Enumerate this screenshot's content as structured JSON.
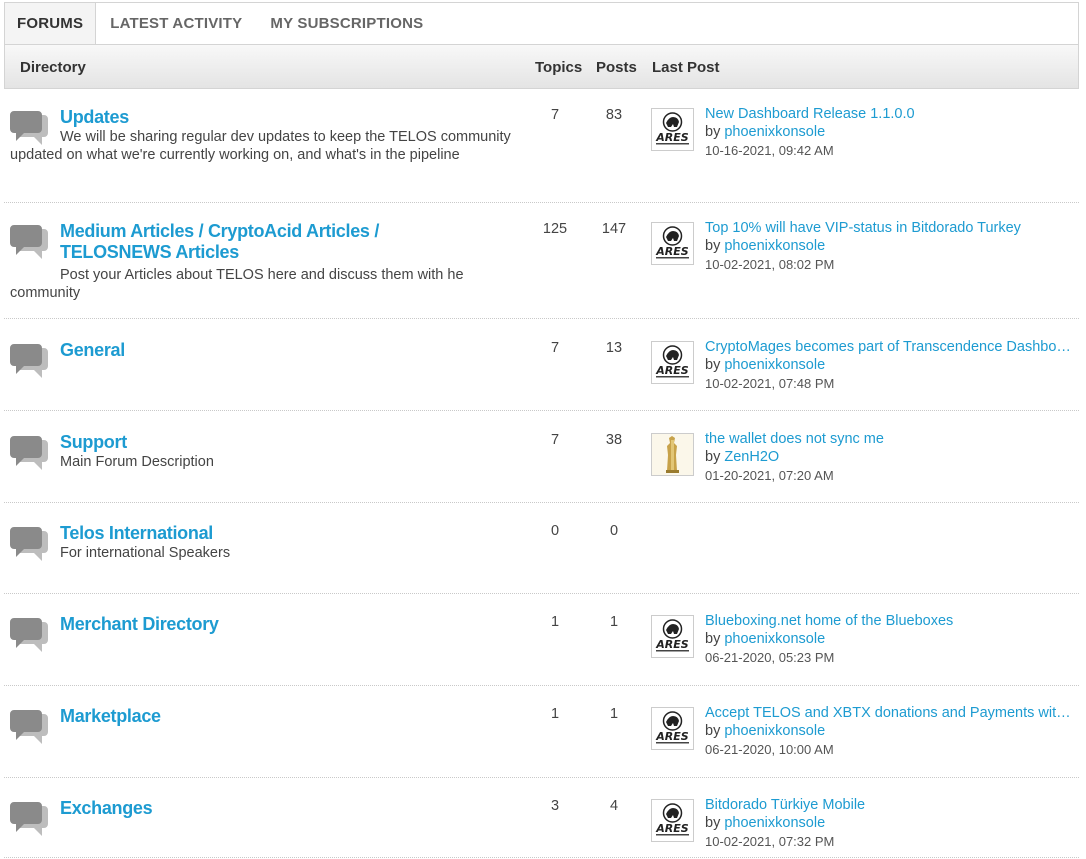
{
  "tabs": [
    {
      "label": "FORUMS"
    },
    {
      "label": "LATEST ACTIVITY"
    },
    {
      "label": "MY SUBSCRIPTIONS"
    }
  ],
  "header": {
    "directory": "Directory",
    "topics": "Topics",
    "posts": "Posts",
    "last_post": "Last Post"
  },
  "forums": [
    {
      "title": "Updates",
      "description": "We will be sharing regular dev updates to keep the TELOS community updated on what we're currently working on, and what's in the pipeline",
      "topics": "7",
      "posts": "83",
      "last_post": {
        "title": "New Dashboard Release 1.1.0.0",
        "by": "by",
        "author": "phoenixkonsole",
        "date": "10-16-2021, 09:42 AM",
        "avatar": "ares-logo"
      }
    },
    {
      "title": "Medium Articles / CryptoAcid Articles / TELOSNEWS Articles",
      "description": "Post your Articles about TELOS here and discuss them with he community",
      "topics": "125",
      "posts": "147",
      "last_post": {
        "title": "Top 10% will have VIP-status in Bitdorado Turkey",
        "by": "by",
        "author": "phoenixkonsole",
        "date": "10-02-2021, 08:02 PM",
        "avatar": "ares-logo"
      }
    },
    {
      "title": "General",
      "description": "",
      "topics": "7",
      "posts": "13",
      "last_post": {
        "title": "CryptoMages becomes part of Transcendence Dashboard",
        "by": "by",
        "author": "phoenixkonsole",
        "date": "10-02-2021, 07:48 PM",
        "avatar": "ares-logo"
      }
    },
    {
      "title": "Support",
      "description": "Main Forum Description",
      "topics": "7",
      "posts": "38",
      "last_post": {
        "title": "the wallet does not sync me",
        "by": "by",
        "author": "ZenH2O",
        "date": "01-20-2021, 07:20 AM",
        "avatar": "gold-figure"
      }
    },
    {
      "title": "Telos International",
      "description": "For international Speakers",
      "topics": "0",
      "posts": "0",
      "last_post": null
    },
    {
      "title": "Merchant Directory",
      "description": "",
      "topics": "1",
      "posts": "1",
      "last_post": {
        "title": "Blueboxing.net home of the Blueboxes",
        "by": "by",
        "author": "phoenixkonsole",
        "date": "06-21-2020, 05:23 PM",
        "avatar": "ares-logo"
      }
    },
    {
      "title": "Marketplace",
      "description": "",
      "topics": "1",
      "posts": "1",
      "last_post": {
        "title": "Accept TELOS and XBTX donations and Payments with Blueboxing",
        "by": "by",
        "author": "phoenixkonsole",
        "date": "06-21-2020, 10:00 AM",
        "avatar": "ares-logo"
      }
    },
    {
      "title": "Exchanges",
      "description": "",
      "topics": "3",
      "posts": "4",
      "last_post": {
        "title": "Bitdorado Türkiye Mobile",
        "by": "by",
        "author": "phoenixkonsole",
        "date": "10-02-2021, 07:32 PM",
        "avatar": "ares-logo"
      }
    }
  ],
  "colors": {
    "link": "#1d9bd1",
    "icon": "#8a8a8a"
  }
}
